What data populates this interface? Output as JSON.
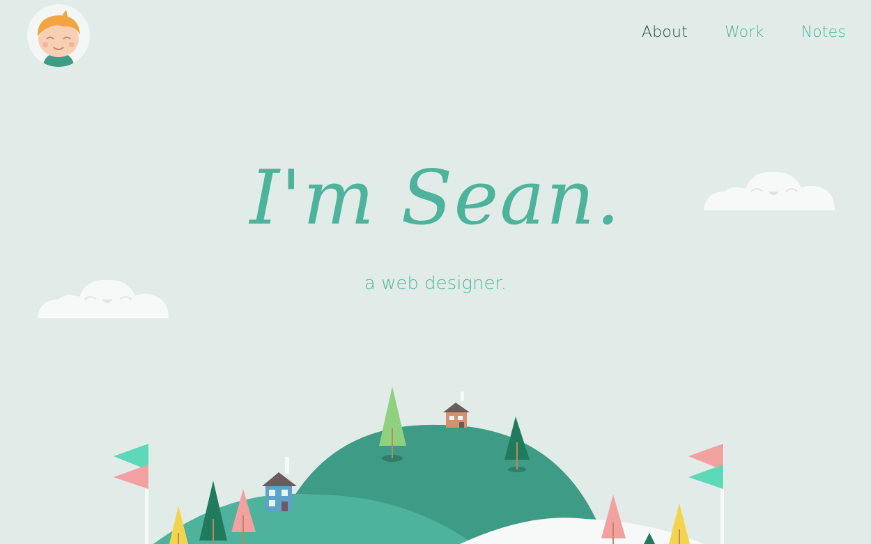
{
  "logo": {
    "alt": "Sean avatar"
  },
  "nav": {
    "items": [
      {
        "label": "About",
        "active": true
      },
      {
        "label": "Work",
        "active": false
      },
      {
        "label": "Notes",
        "active": false
      }
    ]
  },
  "hero": {
    "title": "I'm Sean.",
    "subtitle": "a web designer."
  },
  "colors": {
    "background": "#e1ebe7",
    "accent": "#4db39c",
    "nav_active": "#2a4a40",
    "hill_dark": "#3d9b86",
    "hill_light": "#4db39c",
    "tree_dark": "#1f7a5e",
    "tree_pink": "#f2a0a0",
    "tree_yellow": "#f5d44d",
    "tree_light": "#8fd17e",
    "flag_mint": "#5dd8b8"
  }
}
